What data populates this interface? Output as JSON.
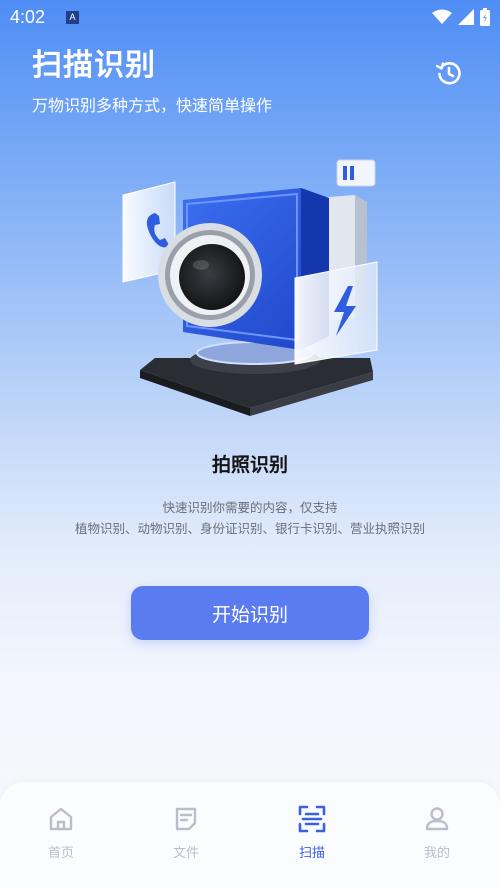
{
  "status_bar": {
    "time": "4:02",
    "app_icon_letter": "A"
  },
  "header": {
    "title": "扫描识别",
    "subtitle": "万物识别多种方式，快速简单操作"
  },
  "card": {
    "title": "拍照识别",
    "desc_line1": "快速识别你需要的内容，仅支持",
    "desc_line2": "植物识别、动物识别、身份证识别、银行卡识别、营业执照识别"
  },
  "start_button_label": "开始识别",
  "tabs": [
    {
      "label": "首页",
      "icon": "home-icon",
      "active": false
    },
    {
      "label": "文件",
      "icon": "file-icon",
      "active": false
    },
    {
      "label": "扫描",
      "icon": "scan-icon",
      "active": true
    },
    {
      "label": "我的",
      "icon": "profile-icon",
      "active": false
    }
  ],
  "colors": {
    "accent": "#5a7cf0",
    "active_tab": "#3b62de",
    "inactive_tab": "#b9bfca"
  }
}
